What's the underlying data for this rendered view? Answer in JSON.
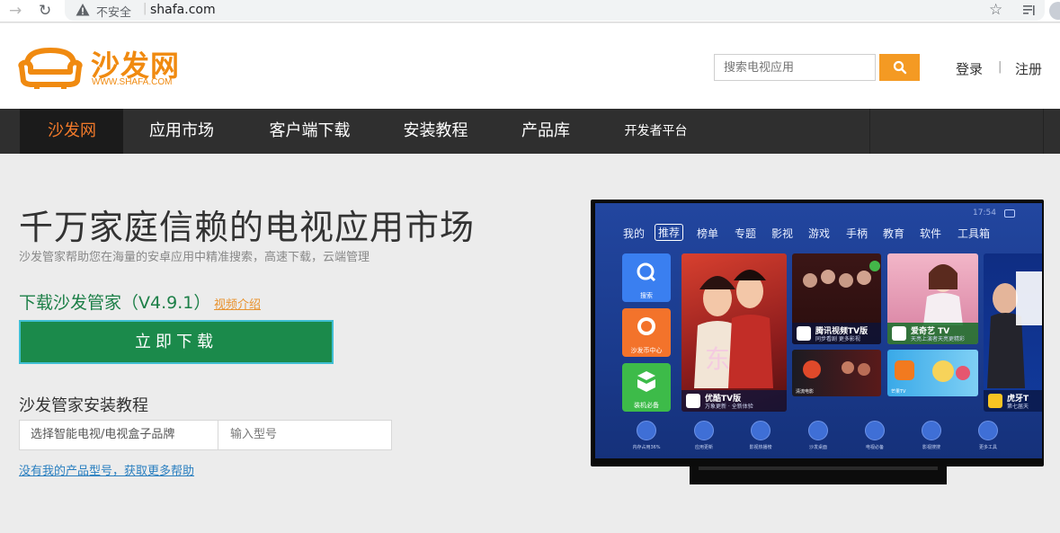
{
  "browser": {
    "insecure_label": "不安全",
    "url": "shafa.com"
  },
  "header": {
    "logo_cn": "沙发网",
    "logo_en": "WWW.SHAFA.COM",
    "search_placeholder": "搜索电视应用",
    "login": "登录",
    "separator": "|",
    "register": "注册"
  },
  "nav": {
    "items": [
      "沙发网",
      "应用市场",
      "客户端下载",
      "安装教程",
      "产品库",
      "开发者平台"
    ]
  },
  "main": {
    "headline": "千万家庭信赖的电视应用市场",
    "subline": "沙发管家帮助您在海量的安卓应用中精准搜索，高速下载，云端管理",
    "download_title": "下载沙发管家（V4.9.1）",
    "video_link": "视频介绍",
    "download_button": "立即下载",
    "tutorial_title": "沙发管家安装教程",
    "brand_select": "选择智能电视/电视盒子品牌",
    "model_placeholder": "输入型号",
    "help_link": "没有我的产品型号，获取更多帮助"
  },
  "tv": {
    "time": "17:54",
    "tabs": [
      "我的",
      "推荐",
      "榜单",
      "专题",
      "影视",
      "游戏",
      "手柄",
      "教育",
      "软件",
      "工具箱"
    ],
    "side_tiles": [
      "搜索",
      "沙发币中心",
      "装机必备"
    ],
    "tiles": [
      {
        "title": "优酷TV版",
        "sub": "万象更新 · 全新体验"
      },
      {
        "title": "腾讯视频TV版",
        "sub": "同步看剧 更多影视"
      },
      {
        "title": "爱奇艺 TV",
        "sub": "天亮上演者天亮更精彩"
      },
      {
        "title": "虎牙T",
        "sub": "第七届天"
      }
    ],
    "banner_title": "东",
    "bottom_labels": [
      "内存占用36%",
      "应用更新",
      "影视热播榜",
      "沙发桌面",
      "电视必备",
      "影视搜搜",
      "更多工具"
    ],
    "small_labels": [
      "清流电影",
      "芒果TV"
    ]
  },
  "colors": {
    "brand_orange": "#f08a10",
    "nav_bg": "#2f2f2f",
    "download_green": "#1b8a4b",
    "link_blue": "#2a7fc0"
  }
}
